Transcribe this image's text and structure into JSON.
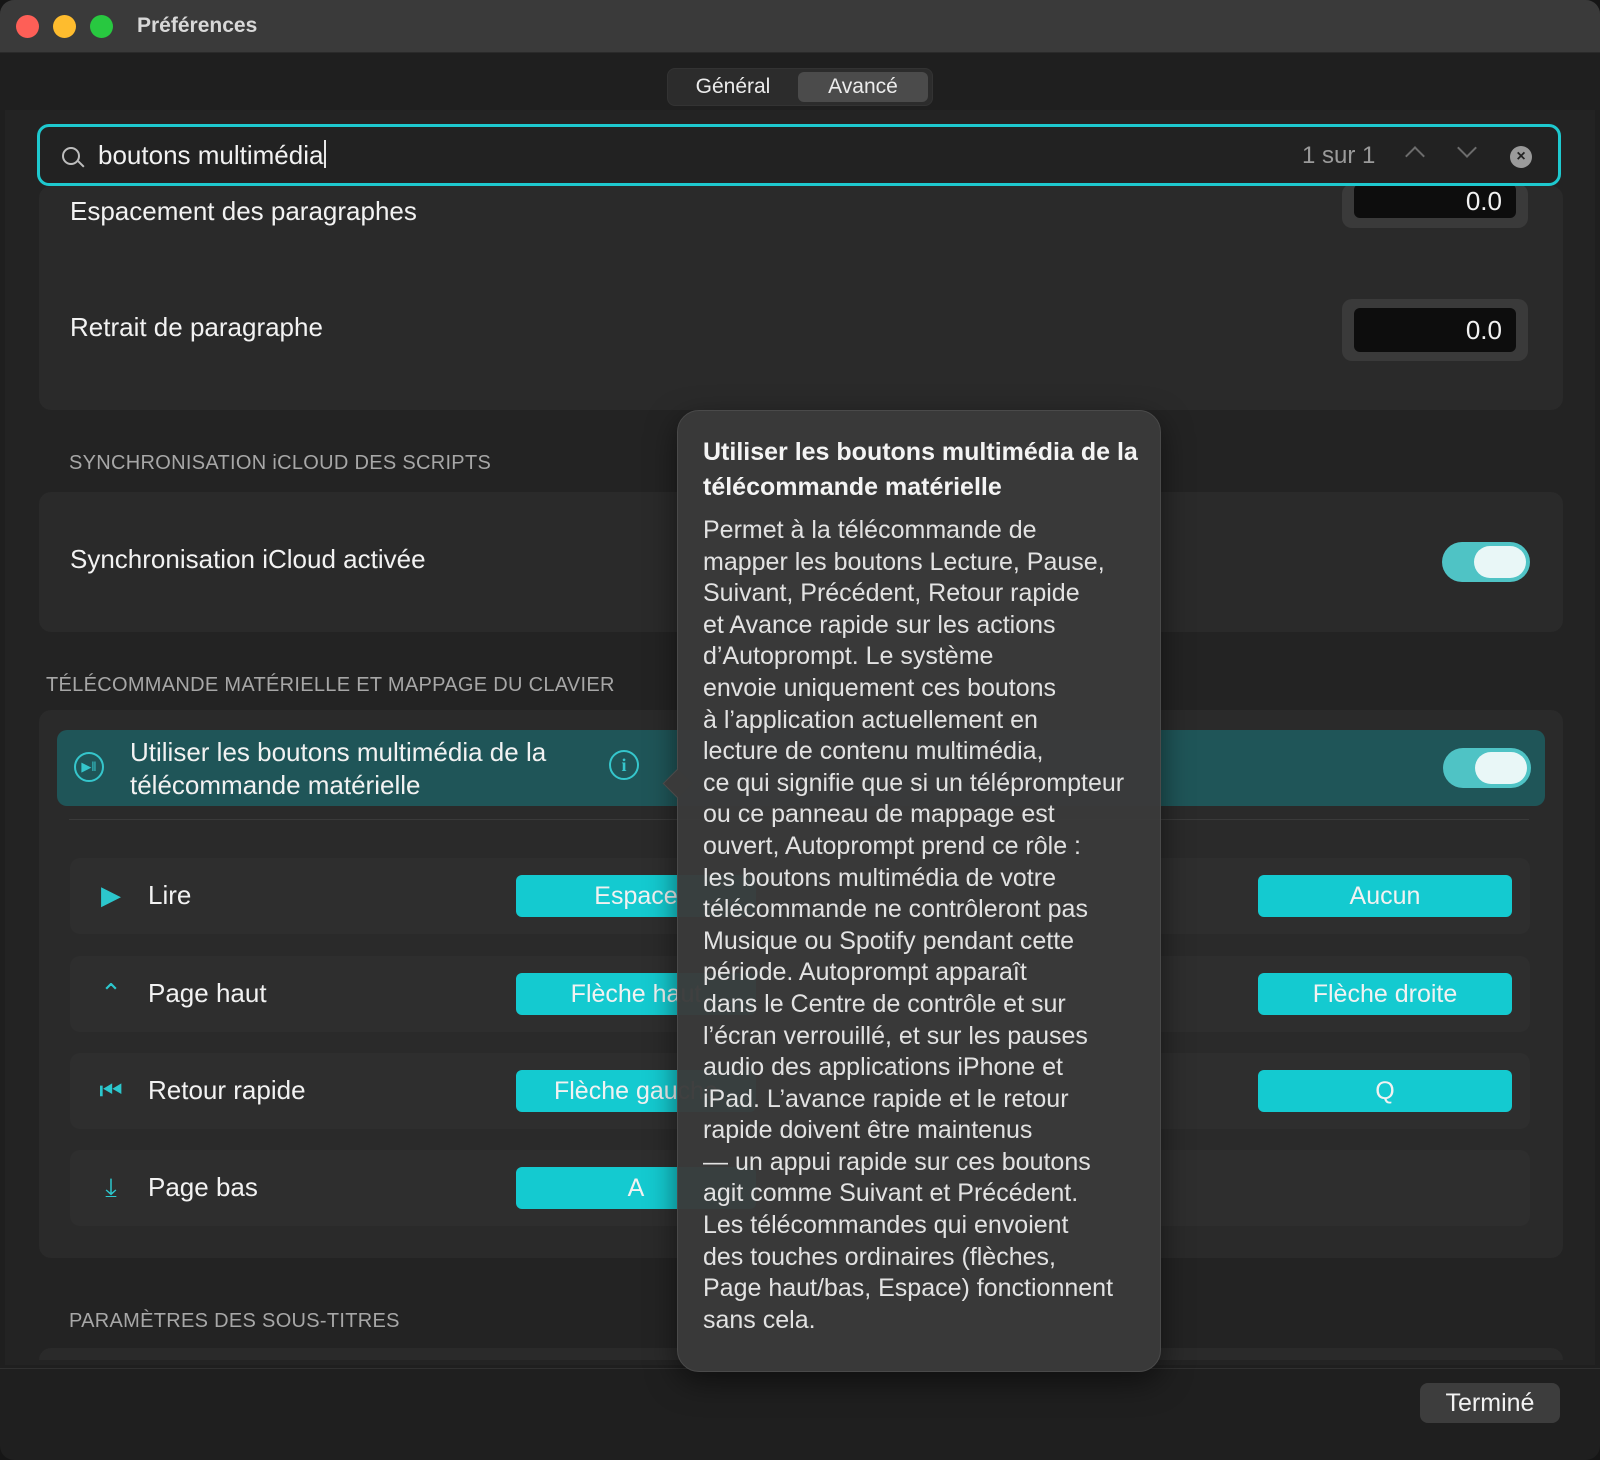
{
  "window": {
    "title": "Préférences"
  },
  "tabs": [
    {
      "label": "Général",
      "selected": false
    },
    {
      "label": "Avancé",
      "selected": true
    }
  ],
  "search": {
    "value": "boutons multimédia",
    "match_count": "1 sur 1"
  },
  "text_settings": [
    {
      "label": "Espacement des paragraphes",
      "value": "0.0"
    },
    {
      "label": "Retrait de paragraphe",
      "value": "0.0"
    }
  ],
  "icloud_section": {
    "header": "SYNCHRONISATION iCLOUD DES SCRIPTS",
    "label": "Synchronisation iCloud activée",
    "enabled": true
  },
  "remote_section": {
    "header": "TÉLÉCOMMANDE MATÉRIELLE ET MAPPAGE DU CLAVIER",
    "media_toggle_label_line1": "Utiliser les boutons multimédia de la",
    "media_toggle_label_line2": "télécommande matérielle",
    "media_enabled": true,
    "mappings": [
      {
        "icon": "play-icon",
        "label": "Lire",
        "key1": "Espace",
        "key2": "Aucun"
      },
      {
        "icon": "chevron-up-icon",
        "label": "Page haut",
        "key1": "Flèche haut",
        "key2": "Flèche droite"
      },
      {
        "icon": "skip-back-icon",
        "label": "Retour rapide",
        "key1": "Flèche gauche",
        "key2": "Q"
      },
      {
        "icon": "arrow-down-icon",
        "label": "Page bas",
        "key1": "A",
        "key2": ""
      }
    ]
  },
  "subtitles_section": {
    "header": "PARAMÈTRES DES SOUS-TITRES"
  },
  "popover": {
    "title": "Utiliser les boutons multimédia de la télécommande matérielle",
    "body_lines": [
      "Permet à la télécommande de",
      "mapper les boutons Lecture, Pause,",
      "Suivant, Précédent, Retour rapide",
      "et Avance rapide sur les actions",
      "d’Autoprompt. Le système",
      "envoie uniquement ces boutons",
      "à l’application actuellement en",
      "lecture de contenu multimédia,",
      "ce qui signifie que si un téléprompteur",
      "ou ce panneau de mappage est",
      "ouvert, Autoprompt prend ce rôle :",
      "les boutons multimédia de votre",
      "télécommande ne contrôleront pas",
      "Musique ou Spotify pendant cette",
      "période. Autoprompt apparaît",
      "dans le Centre de contrôle et sur",
      "l’écran verrouillé, et sur les pauses",
      "audio des applications iPhone et",
      "iPad. L’avance rapide et le retour",
      "rapide doivent être maintenus",
      "— un appui rapide sur ces boutons",
      "agit comme Suivant et Précédent.",
      "Les télécommandes qui envoient",
      "des touches ordinaires (flèches,",
      "Page haut/bas, Espace) fonctionnent",
      "sans cela."
    ]
  },
  "footer": {
    "done_label": "Terminé"
  },
  "colors": {
    "accent": "#14cad0",
    "highlight_row": "#1f5558",
    "toggle_on": "#4fc3c5"
  }
}
